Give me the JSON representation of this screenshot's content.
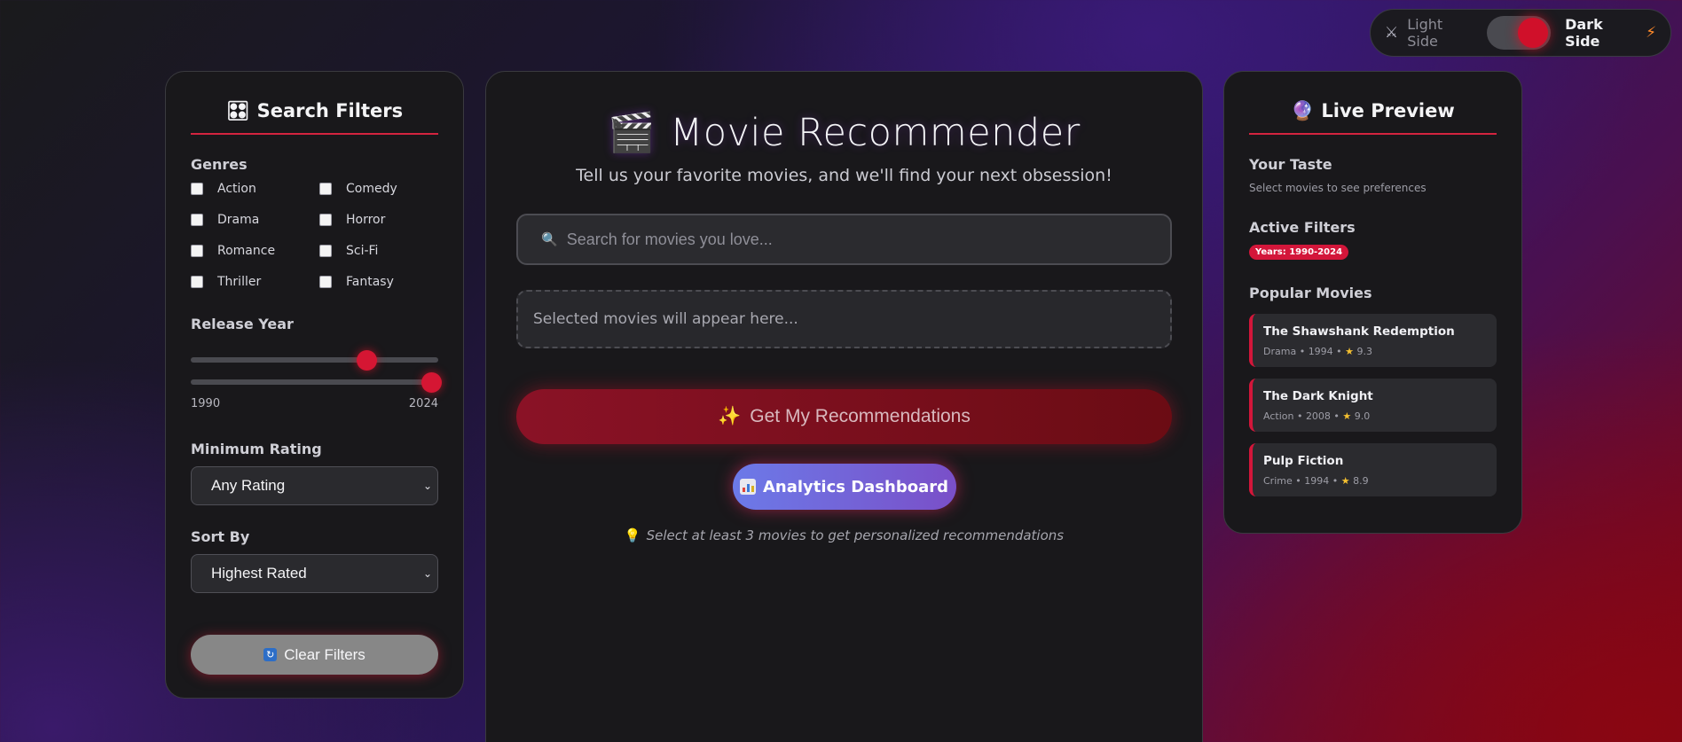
{
  "theme_toggle": {
    "light_label": "Light Side",
    "dark_label": "Dark Side",
    "light_icon": "crossed-swords-icon",
    "dark_icon": "lightning-icon",
    "state": "dark"
  },
  "filters": {
    "title": "Search Filters",
    "title_icon": "control-knobs-icon",
    "genres_label": "Genres",
    "genres": [
      {
        "label": "Action",
        "checked": false
      },
      {
        "label": "Comedy",
        "checked": false
      },
      {
        "label": "Drama",
        "checked": false
      },
      {
        "label": "Horror",
        "checked": false
      },
      {
        "label": "Romance",
        "checked": false
      },
      {
        "label": "Sci-Fi",
        "checked": false
      },
      {
        "label": "Thriller",
        "checked": false
      },
      {
        "label": "Fantasy",
        "checked": false
      }
    ],
    "release_year_label": "Release Year",
    "year_min_label": "1990",
    "year_max_label": "2024",
    "year_slider_start_fraction": 0.71,
    "year_slider_end_fraction": 0.97,
    "min_rating_label": "Minimum Rating",
    "min_rating_value": "Any Rating",
    "sort_label": "Sort By",
    "sort_value": "Highest Rated",
    "clear_button": "Clear Filters",
    "clear_icon": "refresh-icon"
  },
  "main": {
    "title": "Movie Recommender",
    "title_icon": "clapperboard-icon",
    "subtitle": "Tell us your favorite movies, and we'll find your next obsession!",
    "search_placeholder": "Search for movies you love...",
    "search_icon": "magnifier-icon",
    "selected_placeholder": "Selected movies will appear here...",
    "recommend_button": "Get My Recommendations",
    "recommend_icon": "sparkles-icon",
    "analytics_button": "Analytics Dashboard",
    "analytics_icon": "bar-chart-icon",
    "hint": "Select at least 3 movies to get personalized recommendations",
    "hint_icon": "light-bulb-icon"
  },
  "preview": {
    "title": "Live Preview",
    "title_icon": "crystal-ball-icon",
    "taste_label": "Your Taste",
    "taste_desc": "Select movies to see preferences",
    "active_filters_label": "Active Filters",
    "active_badge": "Years: 1990-2024",
    "popular_label": "Popular Movies",
    "movies": [
      {
        "title": "The Shawshank Redemption",
        "genre": "Drama",
        "year": "1994",
        "rating": "9.3"
      },
      {
        "title": "The Dark Knight",
        "genre": "Action",
        "year": "2008",
        "rating": "9.0"
      },
      {
        "title": "Pulp Fiction",
        "genre": "Crime",
        "year": "1994",
        "rating": "8.9"
      }
    ]
  },
  "colors": {
    "accent": "#d3163a",
    "panel_bg": "#19181b",
    "analytics_gradient_start": "#6c7ae8",
    "analytics_gradient_end": "#7a4fc8"
  }
}
